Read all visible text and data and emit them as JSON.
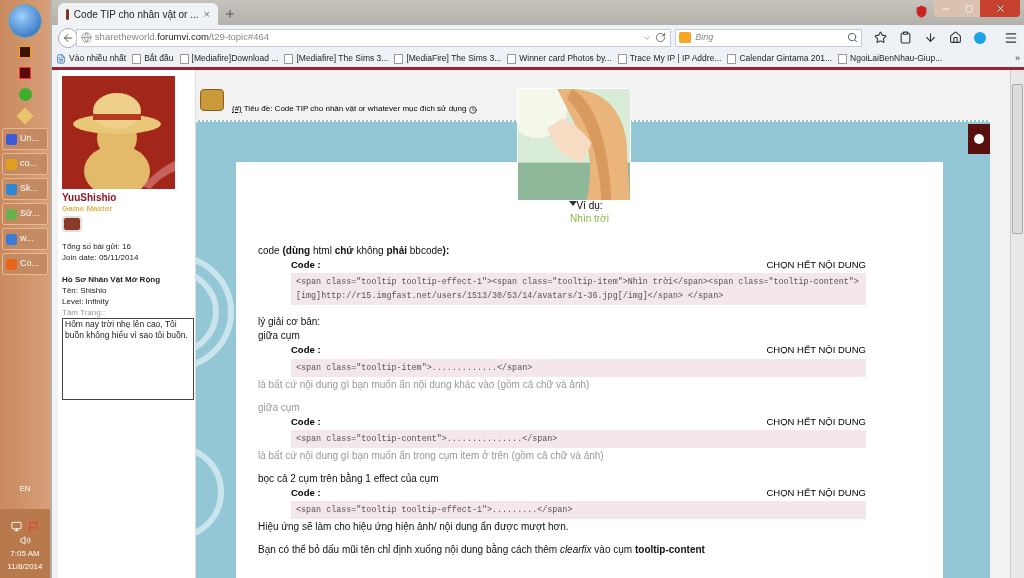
{
  "taskbar": {
    "apps": [
      {
        "label": "Un..."
      },
      {
        "label": "co..."
      },
      {
        "label": "Sk..."
      },
      {
        "label": "Sử..."
      },
      {
        "label": "w..."
      },
      {
        "label": "Co..."
      }
    ],
    "language": "EN",
    "time": "7:05 AM",
    "date": "11/8/2014"
  },
  "browser": {
    "tab": {
      "title": "Code TIP cho nhân vật or ...",
      "close": "×"
    },
    "url": {
      "prefix": "sharetheworld.",
      "domain": "forumvi.com",
      "path": "/t29-topic#464"
    },
    "search": {
      "placeholder": "Bing"
    },
    "bookmarks": [
      "Vào nhiều nhất",
      "Bắt đầu",
      "[Mediafire]Download ...",
      "[Mediafire] The Sims 3...",
      "[MediaFire] The Sims 3...",
      "Winner card Photos by...",
      "Trace My IP | IP Addre...",
      "Calendar Gintama 201...",
      "NgoiLaiBenNhau-Giup..."
    ],
    "more": "»"
  },
  "profile": {
    "username": "YuuShishio",
    "rank": "Game Master",
    "stats": [
      "Tổng số bài gửi: 16",
      "Join date: 05/11/2014"
    ],
    "section_title": "Hồ Sơ Nhân Vật Mở Rộng",
    "fields": [
      "Tên: Shishio",
      "Level: Infinity"
    ],
    "mood_label": "Tâm Trạng::",
    "mood": "Hôm nay trời nhẹ lên cao, Tôi buồn không hiểu vì sao tôi buồn."
  },
  "post": {
    "anchor": "(#)",
    "title": "Tiêu đề: Code TIP cho nhân vật or whatever mục đích sử dụng",
    "example_label": "Ví dụ:",
    "example_item": "Nhìn trời",
    "sections": [
      {
        "blocks": [
          {
            "kind": "text",
            "text": "code **(dùng** html **chứ** không **phải** bbcode**):**",
            "muted": false
          },
          {
            "kind": "code",
            "label": "Code :",
            "action": "CHỌN HẾT NỘI DUNG",
            "code": "<span class=\"tooltip tooltip-effect-1\"><span class=\"tooltip-item\">Nhìn trời</span><span class=\"tooltip-content\">[img]http://r15.imgfast.net/users/1513/30/53/14/avatars/1-36.jpg[/img]</span> </span>"
          }
        ]
      },
      {
        "blocks": [
          {
            "kind": "text",
            "text": "lý giải cơ bản:",
            "muted": false
          },
          {
            "kind": "text",
            "text": "giữa cụm",
            "muted": false
          },
          {
            "kind": "code",
            "label": "Code :",
            "action": "CHỌN HẾT NỘI DUNG",
            "code": "<span class=\"tooltip-item\">.............</span>"
          },
          {
            "kind": "text",
            "text": "là bất cứ nội dung gì bạn muốn ẩn nội dung khác vào (gồm cả chữ và ảnh)",
            "muted": true
          }
        ]
      },
      {
        "blocks": [
          {
            "kind": "text",
            "text": "giữa cụm",
            "muted": true
          },
          {
            "kind": "code",
            "label": "Code :",
            "action": "CHỌN HẾT NỘI DUNG",
            "code": "<span class=\"tooltip-content\">...............</span>"
          },
          {
            "kind": "text",
            "text": "là bất cứ nội dung gì bạn muốn ẩn trong cụm item ở trên (gồm cả chữ và ảnh)",
            "muted": true
          }
        ]
      },
      {
        "blocks": [
          {
            "kind": "text",
            "text": "bọc cả 2 cụm trên bằng 1 effect của cụm",
            "muted": false
          },
          {
            "kind": "code",
            "label": "Code :",
            "action": "CHỌN HẾT NỘI DUNG",
            "code": "<span class=\"tooltip tooltip-effect-1\">.........</span>"
          },
          {
            "kind": "text",
            "text": "Hiệu ứng sẽ làm cho hiệu ứng hiện ảnh/ nội dung ẩn được mượt hơn.",
            "muted": false
          }
        ]
      },
      {
        "blocks": [
          {
            "kind": "text",
            "text": "Bạn có thể bỏ dấu mũi tên chỉ định xuống nội dung bằng cách thêm *clearfix* vào cụm **tooltip-content**",
            "muted": false
          }
        ]
      }
    ]
  }
}
